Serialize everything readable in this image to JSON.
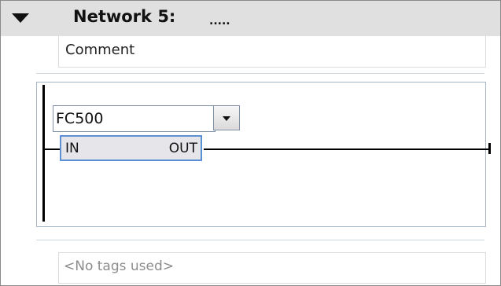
{
  "network": {
    "title": "Network 5:",
    "title_dots": ".....",
    "comment": "Comment"
  },
  "block": {
    "name": "FC500",
    "input_pin": "IN",
    "output_pin": "OUT"
  },
  "tags": {
    "text": "<No tags used>"
  },
  "colors": {
    "header_bg": "#e0e0e0",
    "block_border": "#5b8fd6",
    "block_fill": "#e6e6ea"
  }
}
